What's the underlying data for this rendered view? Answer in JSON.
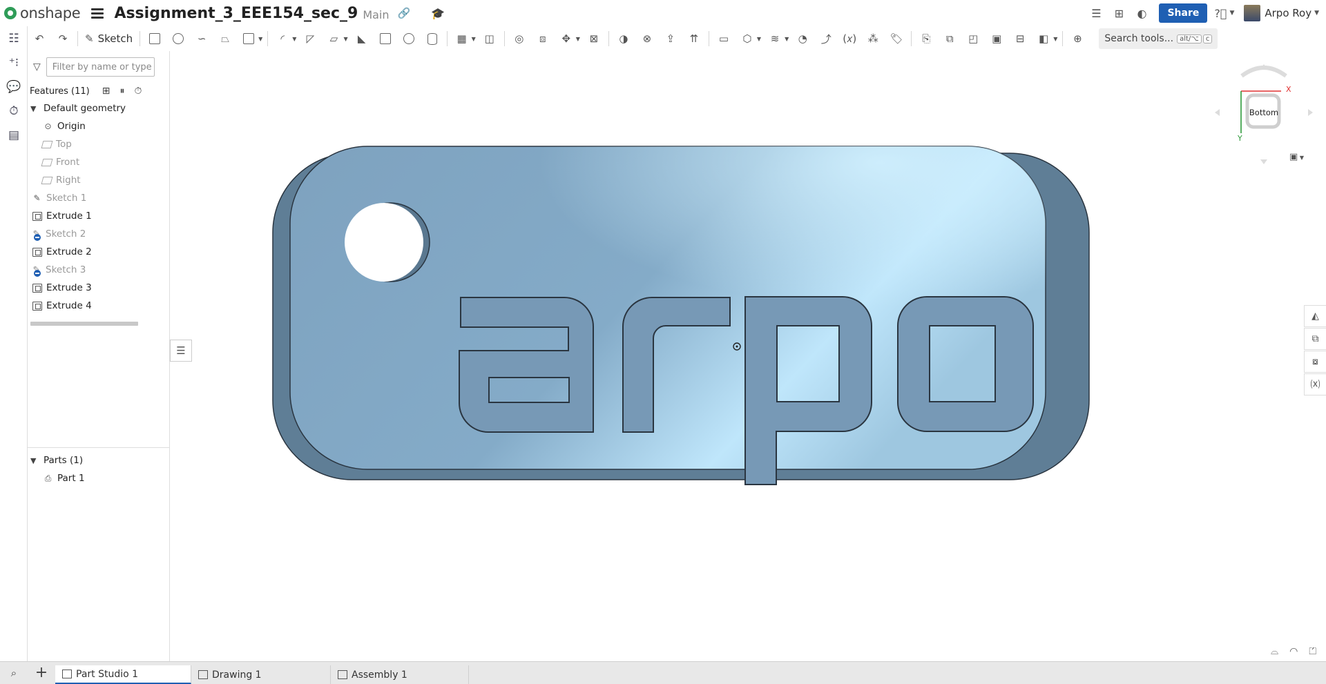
{
  "topbar": {
    "app_name": "onshape",
    "document_title": "Assignment_3_EEE154_sec_9",
    "branch": "Main",
    "share_label": "Share",
    "user_name": "Arpo Roy"
  },
  "toolbar": {
    "sketch_label": "Sketch",
    "search_label": "Search tools...",
    "search_shortcut_1": "alt/⌥",
    "search_shortcut_2": "c"
  },
  "features": {
    "filter_placeholder": "Filter by name or type",
    "header": "Features (11)",
    "default_geometry_label": "Default geometry",
    "items": [
      {
        "label": "Origin"
      },
      {
        "label": "Top"
      },
      {
        "label": "Front"
      },
      {
        "label": "Right"
      },
      {
        "label": "Sketch 1"
      },
      {
        "label": "Extrude 1"
      },
      {
        "label": "Sketch 2"
      },
      {
        "label": "Extrude 2"
      },
      {
        "label": "Sketch 3"
      },
      {
        "label": "Extrude 3"
      },
      {
        "label": "Extrude 4"
      }
    ]
  },
  "parts": {
    "header": "Parts (1)",
    "items": [
      {
        "label": "Part 1"
      }
    ]
  },
  "viewcube": {
    "face_label": "Bottom",
    "x_axis_label": "X",
    "y_axis_label": "Y",
    "x_color": "#e03030",
    "y_color": "#2e9a3a"
  },
  "model": {
    "engraved_text": "arpo",
    "body_color": "#7fa3bf",
    "highlight_color": "#bfe6fb",
    "edge_color": "#2a3540"
  },
  "tabs": [
    {
      "label": "Part Studio 1"
    },
    {
      "label": "Drawing 1"
    },
    {
      "label": "Assembly 1"
    }
  ],
  "colors": {
    "accent": "#1f5fb3",
    "brand_green": "#2f9c58"
  }
}
